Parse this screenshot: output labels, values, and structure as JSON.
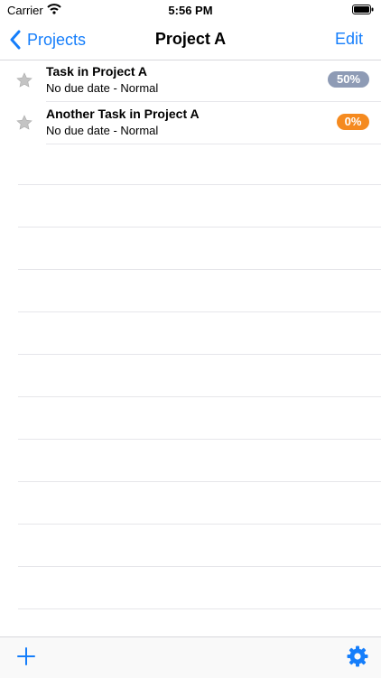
{
  "status_bar": {
    "carrier": "Carrier",
    "time": "5:56 PM"
  },
  "nav": {
    "back_label": "Projects",
    "title": "Project A",
    "edit_label": "Edit"
  },
  "tasks": [
    {
      "title": "Task in Project A",
      "subtitle": "No due date - Normal",
      "progress": "50%",
      "badge_color": "#8e9bb5",
      "starred": false
    },
    {
      "title": "Another Task in Project A",
      "subtitle": "No due date - Normal",
      "progress": "0%",
      "badge_color": "#f58a1f",
      "starred": false
    }
  ],
  "colors": {
    "accent": "#157efb",
    "separator": "#e6e6ea",
    "star": "#c4c4c4"
  },
  "icons": {
    "back": "chevron-left-icon",
    "star": "star-icon",
    "add": "plus-icon",
    "settings": "gear-icon"
  }
}
